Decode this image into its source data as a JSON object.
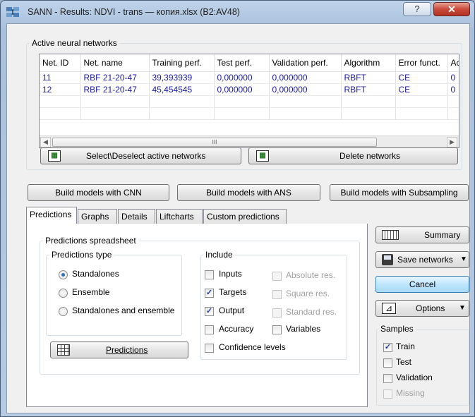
{
  "window": {
    "title": "SANN - Results: NDVI - trans — копия.xlsx (B2:AV48)",
    "help_label": "?",
    "close_label": "✕"
  },
  "networks_group": {
    "title": "Active neural networks",
    "columns": [
      "Net. ID",
      "Net. name",
      "Training perf.",
      "Test perf.",
      "Validation perf.",
      "Algorithm",
      "Error funct.",
      "Ac"
    ],
    "rows": [
      [
        "11",
        "RBF 21-20-47",
        "39,393939",
        "0,000000",
        "0,000000",
        "RBFT",
        "CE",
        "0"
      ],
      [
        "12",
        "RBF 21-20-47",
        "45,454545",
        "0,000000",
        "0,000000",
        "RBFT",
        "CE",
        "0"
      ]
    ],
    "scroll_thumb_glyph": "III",
    "select_button": "Select\\Deselect active networks",
    "delete_button": "Delete networks"
  },
  "build_buttons": {
    "cnn": "Build models with CNN",
    "ans": "Build  models with ANS",
    "subsampling": "Build models with Subsampling"
  },
  "tabs": [
    "Predictions",
    "Graphs",
    "Details",
    "Liftcharts",
    "Custom predictions"
  ],
  "predictions": {
    "group_title": "Predictions spreadsheet",
    "type_title": "Predictions type",
    "type_options": [
      {
        "label": "Standalones",
        "selected": true
      },
      {
        "label": "Ensemble",
        "selected": false
      },
      {
        "label": "Standalones and ensemble",
        "selected": false
      }
    ],
    "include_title": "Include",
    "include_options": [
      {
        "label": "Inputs",
        "checked": false,
        "enabled": true
      },
      {
        "label": "Absolute res.",
        "checked": false,
        "enabled": false
      },
      {
        "label": "Targets",
        "checked": true,
        "enabled": true
      },
      {
        "label": "Square res.",
        "checked": false,
        "enabled": false
      },
      {
        "label": "Output",
        "checked": true,
        "enabled": true
      },
      {
        "label": "Standard res.",
        "checked": false,
        "enabled": false
      },
      {
        "label": "Accuracy",
        "checked": false,
        "enabled": true
      },
      {
        "label": "Variables",
        "checked": false,
        "enabled": true
      },
      {
        "label": "Confidence levels",
        "checked": false,
        "enabled": true
      }
    ],
    "predictions_button": "Predictions"
  },
  "side": {
    "summary_button": "Summary",
    "save_networks_button": "Save networks",
    "cancel_button": "Cancel",
    "options_button": "Options",
    "samples_title": "Samples",
    "samples": [
      {
        "label": "Train",
        "checked": true,
        "enabled": true
      },
      {
        "label": "Test",
        "checked": false,
        "enabled": true
      },
      {
        "label": "Validation",
        "checked": false,
        "enabled": true
      },
      {
        "label": "Missing",
        "checked": false,
        "enabled": false
      }
    ]
  },
  "colors": {
    "accent": "#3c7fb1",
    "grid_text": "#1a1aa6",
    "title_bar": "#bfd3ea",
    "close_button": "#c9493a"
  }
}
